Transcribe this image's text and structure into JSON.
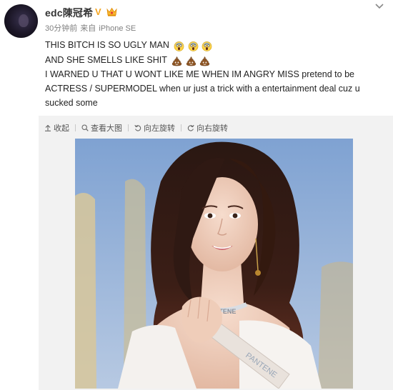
{
  "user": {
    "name": "edc陳冠希",
    "verified_badge": "V",
    "time": "30分钟前",
    "source_prefix": "来自",
    "source": "iPhone SE"
  },
  "post": {
    "lines": [
      "THIS BITCH IS SO UGLY MAN",
      "AND SHE SMELLS LIKE SHIT",
      "I WARNED U THAT U WONT LIKE ME WHEN IM ANGRY MISS pretend to be ACTRESS / SUPERMODEL when ur just a trick with a entertainment deal cuz u sucked some"
    ],
    "line1_emojis": [
      "scream-emoji",
      "scream-emoji",
      "scream-emoji"
    ],
    "line2_emojis": [
      "poop-emoji",
      "poop-emoji",
      "poop-emoji"
    ]
  },
  "toolbar": {
    "collapse": "收起",
    "view_large": "查看大图",
    "rotate_left": "向左旋转",
    "rotate_right": "向右旋转"
  },
  "photo": {
    "sash_text": "PANTENE",
    "necklace_text": "PANTENE"
  },
  "colors": {
    "verified": "#f5a623",
    "panel_bg": "#f2f2f2",
    "sky": "#9fb8d8"
  }
}
